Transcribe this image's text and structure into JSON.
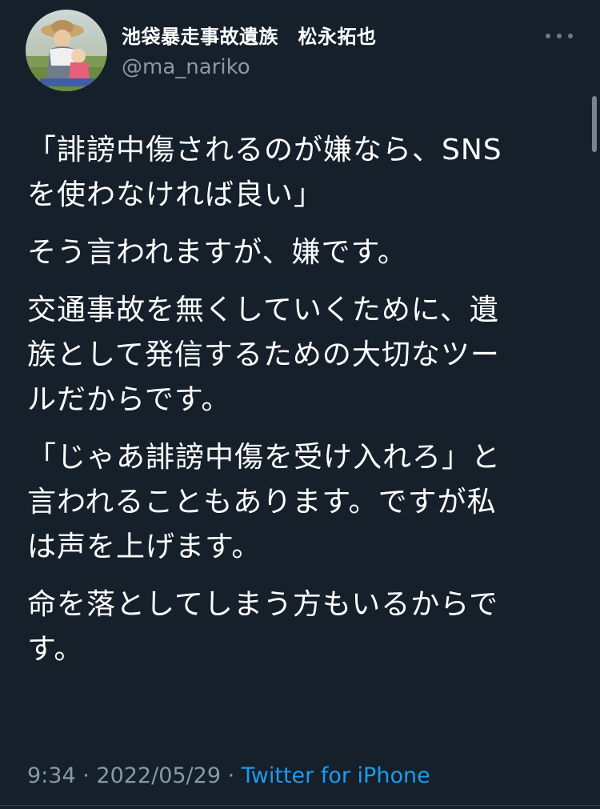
{
  "author": {
    "display_name": "池袋暴走事故遺族　松永拓也",
    "handle": "@ma_nariko"
  },
  "tweet": {
    "paragraphs": [
      "「誹謗中傷されるのが嫌なら、SNS\nを使わなければ良い」",
      "そう言われますが、嫌です。",
      "交通事故を無くしていくために、遺\n族として発信するための大切なツー\nルだからです。",
      "「じゃあ誹謗中傷を受け入れろ」と\n言われることもあります。ですが私\nは声を上げます。",
      "命を落としてしまう方もいるからで\nす。"
    ]
  },
  "meta": {
    "time": "9:34",
    "separator1": " · ",
    "date": "2022/05/29",
    "separator2": " · ",
    "source": "Twitter for iPhone"
  },
  "icons": {
    "avatar": "profile-photo",
    "more": "more-horizontal-icon"
  },
  "colors": {
    "background": "#15202b",
    "text": "#ffffff",
    "secondary_text": "#8b98a5",
    "link": "#1d9bf0"
  }
}
